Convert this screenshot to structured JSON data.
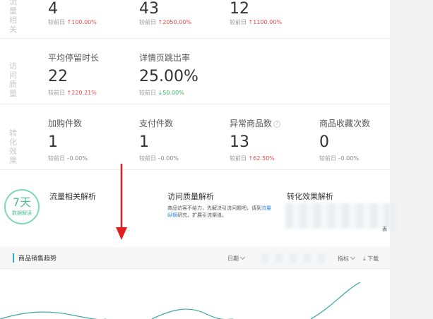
{
  "rows": [
    {
      "label": "流量相关",
      "metrics": [
        {
          "title": "",
          "value": "4",
          "compare_label": "较前日",
          "change": "100.00%",
          "trend": "up"
        },
        {
          "title": "",
          "value": "43",
          "compare_label": "较前日",
          "change": "2050.00%",
          "trend": "up"
        },
        {
          "title": "",
          "value": "12",
          "compare_label": "较前日",
          "change": "1100.00%",
          "trend": "up"
        }
      ]
    },
    {
      "label": "访问质量",
      "metrics": [
        {
          "title": "平均停留时长",
          "value": "22",
          "compare_label": "较前日",
          "change": "220.21%",
          "trend": "up"
        },
        {
          "title": "详情页跳出率",
          "value": "25.00%",
          "compare_label": "较前日",
          "change": "50.00%",
          "trend": "down"
        }
      ]
    },
    {
      "label": "转化效果",
      "metrics": [
        {
          "title": "加购件数",
          "value": "1",
          "compare_label": "较前日",
          "change": "0.00%",
          "trend": "flat"
        },
        {
          "title": "支付件数",
          "value": "1",
          "compare_label": "较前日",
          "change": "0.00%",
          "trend": "flat"
        },
        {
          "title": "异常商品数",
          "value": "13",
          "compare_label": "较前日",
          "change": "62.50%",
          "trend": "up",
          "help": "?"
        },
        {
          "title": "商品收藏次数",
          "value": "0",
          "compare_label": "较前日",
          "change": "0.00%",
          "trend": "flat"
        }
      ]
    }
  ],
  "arrows": {
    "up": "↑",
    "down": "↓",
    "flat": "–"
  },
  "analysis": {
    "badge_big": "7天",
    "badge_small": "数据解读",
    "traffic_title": "流量相关解析",
    "quality_title": "访问质量解析",
    "quality_text_a": "商品访客不给力，先解决引流问题吧，请到",
    "quality_text_link": "流量纵横",
    "quality_text_b": "研究，扩展引流渠道。",
    "conversion_title": "转化效果解析",
    "edge_text": "表"
  },
  "trend": {
    "title": "商品销售趋势",
    "date_label": "日期",
    "metric_label": "指标",
    "download_label": "下载",
    "line_color": "#3aa7a0"
  },
  "colors": {
    "up": "#e84b4b",
    "down": "#35b35e",
    "arrow": "#e02020"
  }
}
